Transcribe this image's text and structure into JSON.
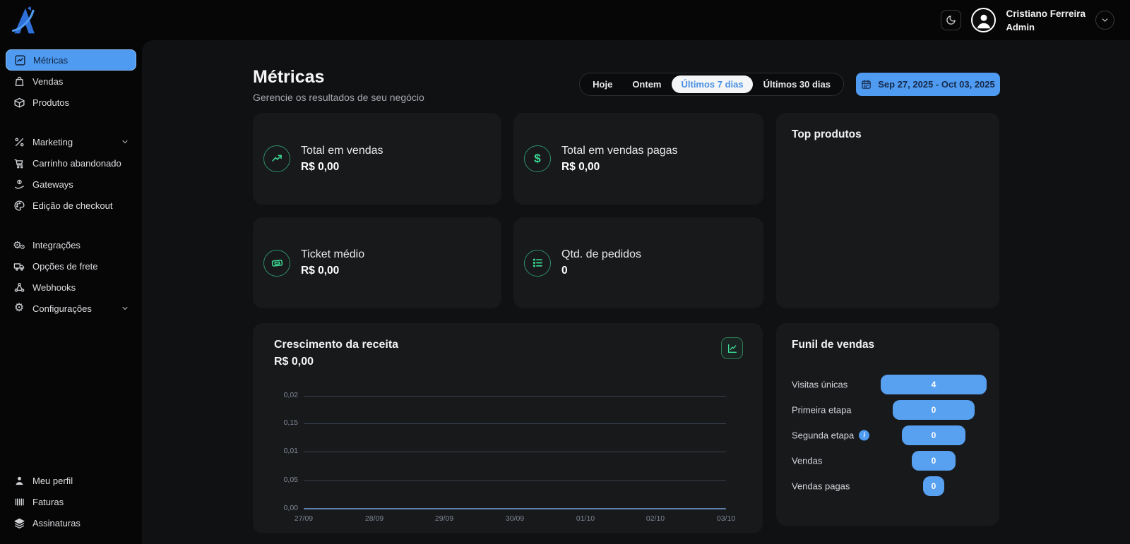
{
  "topbar": {
    "user_name": "Cristiano Ferreira",
    "user_role": "Admin"
  },
  "sidebar": {
    "group1": [
      {
        "label": "Métricas"
      },
      {
        "label": "Vendas"
      },
      {
        "label": "Produtos"
      }
    ],
    "group2": [
      {
        "label": "Marketing"
      },
      {
        "label": "Carrinho abandonado"
      },
      {
        "label": "Gateways"
      },
      {
        "label": "Edição de checkout"
      }
    ],
    "group3": [
      {
        "label": "Integrações"
      },
      {
        "label": "Opções de frete"
      },
      {
        "label": "Webhooks"
      },
      {
        "label": "Configurações"
      }
    ],
    "group4": [
      {
        "label": "Meu perfil"
      },
      {
        "label": "Faturas"
      },
      {
        "label": "Assinaturas"
      }
    ]
  },
  "page": {
    "title": "Métricas",
    "subtitle": "Gerencie os resultados de seu negócio"
  },
  "filters": {
    "options": [
      "Hoje",
      "Ontem",
      "Últimos 7 dias",
      "Últimos 30 dias"
    ],
    "selected": "Últimos 7 dias",
    "date_range": "Sep 27, 2025 - Oct 03, 2025"
  },
  "metrics": {
    "total_sales": {
      "label": "Total em vendas",
      "value": "R$ 0,00"
    },
    "total_paid": {
      "label": "Total em vendas pagas",
      "value": "R$ 0,00"
    },
    "avg_ticket": {
      "label": "Ticket médio",
      "value": "R$ 0,00"
    },
    "orders": {
      "label": "Qtd. de pedidos",
      "value": "0"
    }
  },
  "top_products": {
    "title": "Top produtos"
  },
  "funnel": {
    "title": "Funil de vendas",
    "steps": [
      {
        "label": "Visitas únicas",
        "value": "4"
      },
      {
        "label": "Primeira etapa",
        "value": "0"
      },
      {
        "label": "Segunda etapa",
        "value": "0",
        "info": true
      },
      {
        "label": "Vendas",
        "value": "0"
      },
      {
        "label": "Vendas pagas",
        "value": "0"
      }
    ]
  },
  "chart_data": {
    "type": "line",
    "title": "Crescimento da receita",
    "total": "R$ 0,00",
    "x": [
      "27/09",
      "28/09",
      "29/09",
      "30/09",
      "01/10",
      "02/10",
      "03/10"
    ],
    "y_tick_labels": [
      "0,02",
      "0,15",
      "0,01",
      "0,05",
      "0,00"
    ],
    "series": [
      {
        "name": "Receita",
        "values": [
          0,
          0,
          0,
          0,
          0,
          0,
          0
        ]
      }
    ],
    "ylim": [
      0,
      0.02
    ],
    "grid": true,
    "legend": "none",
    "line_color": "#5b82ad"
  },
  "colors": {
    "accent_blue": "#4e9bf1",
    "funnel_bar": "#58a0f0",
    "green": "#3ddc97",
    "card_bg": "#18191b",
    "main_bg": "#101113",
    "shell_bg": "#060607"
  }
}
